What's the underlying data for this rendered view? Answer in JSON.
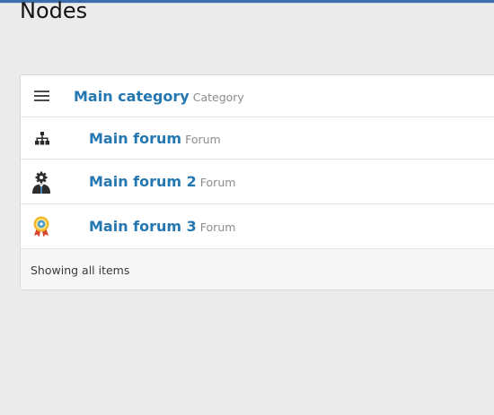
{
  "page": {
    "title": "Nodes"
  },
  "nodes": [
    {
      "title": "Main category",
      "type": "Category",
      "icon": "hamburger-icon"
    },
    {
      "title": "Main forum",
      "type": "Forum",
      "icon": "hierarchy-icon"
    },
    {
      "title": "Main forum 2",
      "type": "Forum",
      "icon": "user-gear-icon"
    },
    {
      "title": "Main forum 3",
      "type": "Forum",
      "icon": "award-ribbon-icon"
    }
  ],
  "footer": {
    "text": "Showing all items"
  },
  "colors": {
    "link": "#2577b1",
    "muted": "#8c8c8c",
    "background": "#ebebeb",
    "accent_bar": "#3b6ea8"
  }
}
